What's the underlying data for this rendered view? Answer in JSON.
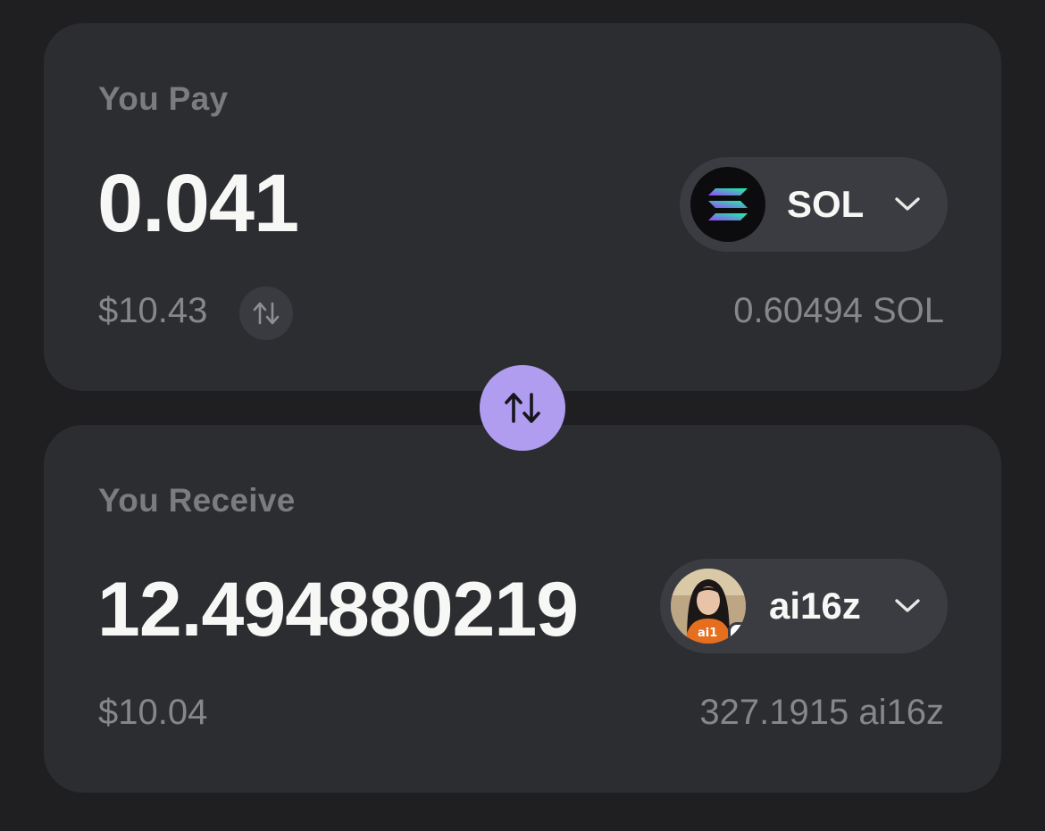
{
  "pay": {
    "label": "You Pay",
    "amount": "0.041",
    "usd_value": "$10.43",
    "token": {
      "symbol": "SOL",
      "icon": "solana-logo-icon"
    },
    "balance": "0.60494 SOL"
  },
  "receive": {
    "label": "You Receive",
    "amount": "12.494880219",
    "usd_value": "$10.04",
    "token": {
      "symbol": "ai16z",
      "icon": "ai16z-avatar-icon",
      "chain_badge": "solana-chain-badge-icon"
    },
    "balance": "327.1915 ai16z"
  },
  "swap_direction_button": {
    "icon": "swap-arrows-icon"
  },
  "colors": {
    "background": "#1f1f21",
    "card": "#2c2d31",
    "pill": "#3b3c41",
    "accent": "#b09df0",
    "primary_text": "#f7f7f5",
    "muted_text": "#86878b"
  }
}
